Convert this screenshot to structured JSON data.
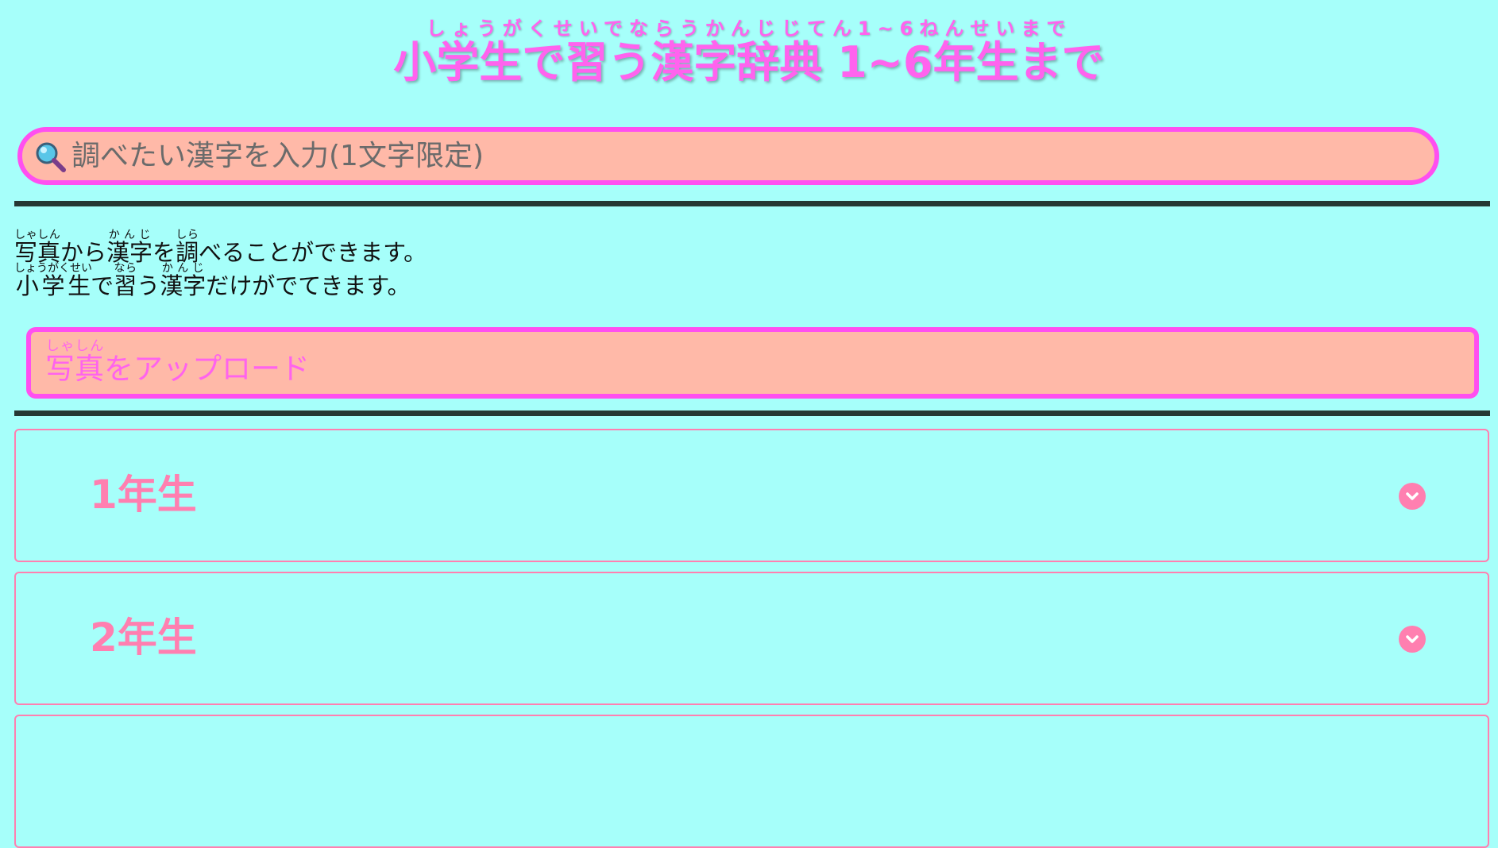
{
  "header": {
    "title_ruby": "しょうがくせいでならうかんじじてん1~6ねんせいまで",
    "title": "小学生で習う漢字辞典 1~6年生まで"
  },
  "search": {
    "placeholder": "調べたい漢字を入力(1文字限定)",
    "icon": "search-icon"
  },
  "description": {
    "line1": [
      {
        "base": "写真",
        "rt": "しゃしん"
      },
      {
        "text": "から"
      },
      {
        "base": "漢字",
        "rt": "かんじ"
      },
      {
        "text": "を"
      },
      {
        "base": "調",
        "rt": "しら"
      },
      {
        "text": "べることができます。"
      }
    ],
    "line2": [
      {
        "base": "小学生",
        "rt": "しょうがくせい"
      },
      {
        "text": "で"
      },
      {
        "base": "習",
        "rt": "なら"
      },
      {
        "text": "う"
      },
      {
        "base": "漢字",
        "rt": "かんじ"
      },
      {
        "text": "だけがでてきます。"
      }
    ]
  },
  "upload": {
    "label": [
      {
        "base": "写真",
        "rt": "しゃしん"
      },
      {
        "text": "をアップロード"
      }
    ]
  },
  "grades": [
    {
      "label": "1年生",
      "icon": "chevron-down-icon"
    },
    {
      "label": "2年生",
      "icon": "chevron-down-icon"
    },
    {
      "label": "",
      "icon": "chevron-down-icon"
    }
  ],
  "colors": {
    "background": "#a6fffa",
    "accent": "#ff63ee",
    "field": "#ffb9a8",
    "grade": "#ff7fb0",
    "divider": "#253833"
  }
}
